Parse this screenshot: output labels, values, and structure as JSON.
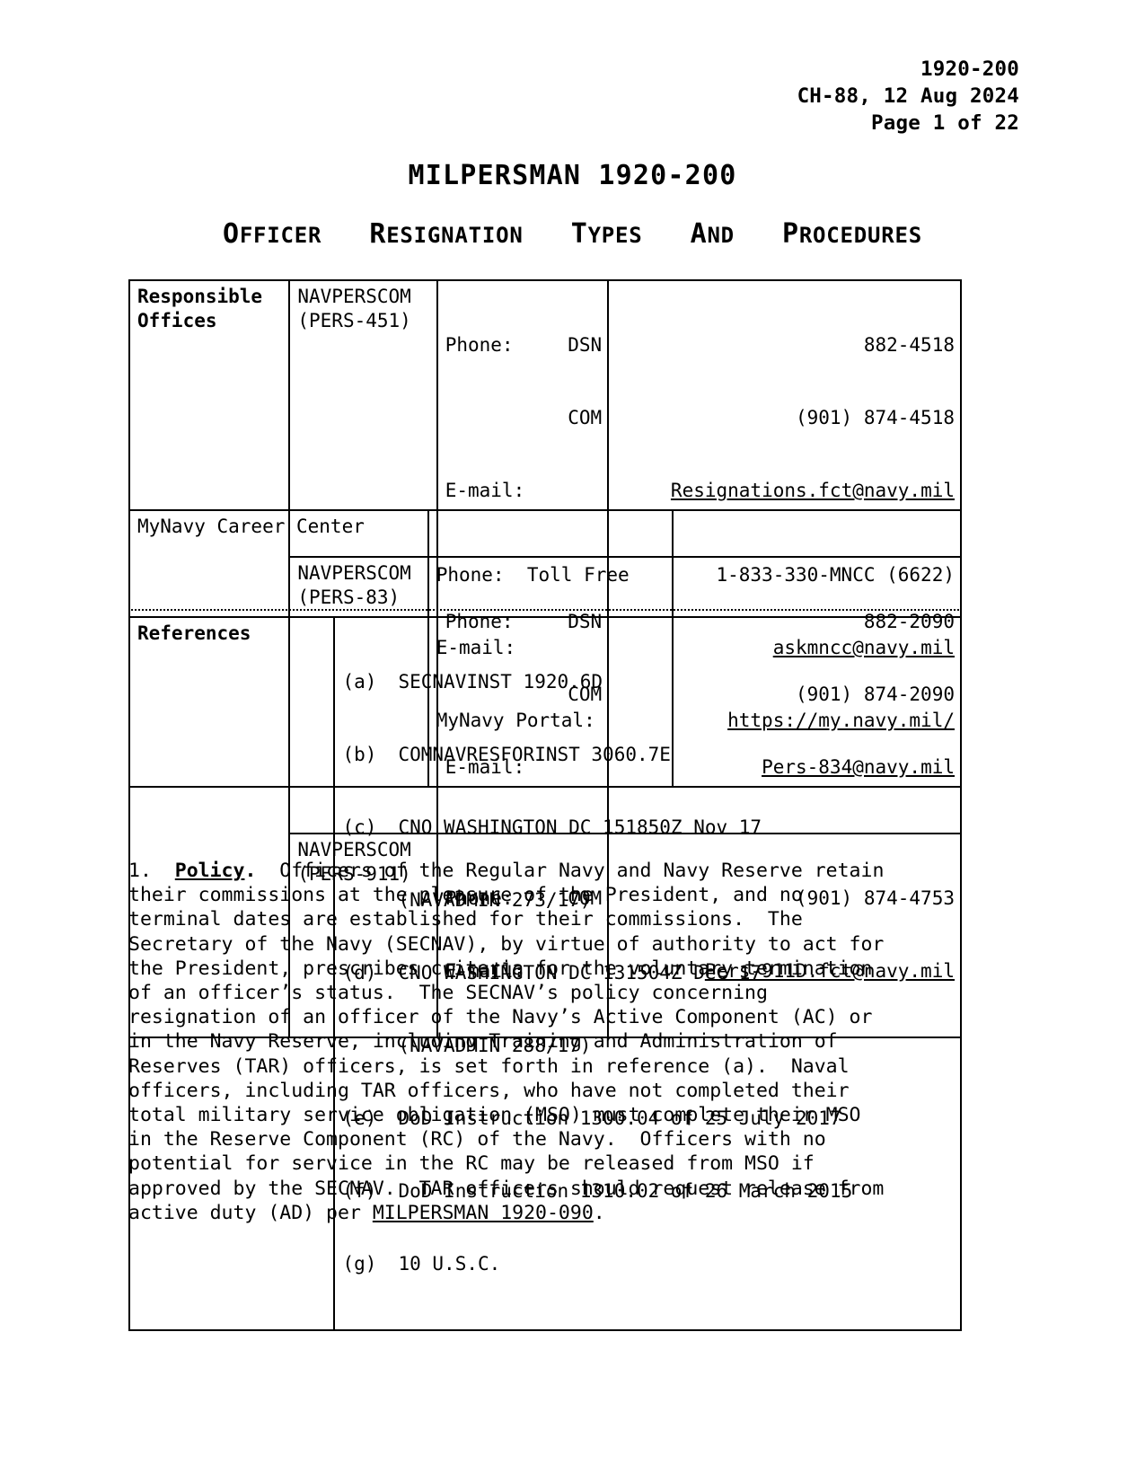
{
  "header": {
    "doc_number": "1920-200",
    "change_line": "CH-88, 12 Aug 2024",
    "page_line": "Page 1 of 22"
  },
  "title": "MILPERSMAN 1920-200",
  "subtitle": {
    "full": "OFFICER RESIGNATION TYPES AND PROCEDURES",
    "words": [
      "Officer",
      "Resignation",
      "Types",
      "and",
      "Procedures"
    ]
  },
  "offices_table": {
    "label": "Responsible\nOffices",
    "label_line1": "Responsible",
    "label_line2": "Offices",
    "rows": [
      {
        "org_line1": "NAVPERSCOM",
        "org_line2": "(PERS-451)",
        "phone_label": "Phone:",
        "dsn_label": "DSN",
        "dsn_value": "882-4518",
        "com_label": "COM",
        "com_value": "(901) 874-4518",
        "email_label": "E-mail:",
        "email_value": "Resignations.fct@navy.mil"
      },
      {
        "org_line1": "NAVPERSCOM",
        "org_line2": "(PERS-83)",
        "phone_label": "Phone:",
        "dsn_label": "DSN",
        "dsn_value": "882-2090",
        "com_label": "COM",
        "com_value": "(901) 874-2090",
        "email_label": "E-mail:",
        "email_value": "Pers-834@navy.mil"
      },
      {
        "org_line1": "NAVPERSCOM",
        "org_line2": "(PERS-911)",
        "phone_label": "Phone:",
        "com_label": "COM",
        "com_value": "(901) 874-4753",
        "email_label": "E-mail:",
        "email_value": "Pers-911D.fct@navy.mil"
      }
    ]
  },
  "mynavy_table": {
    "name": "MyNavy Career Center",
    "phone_label": "Phone:  Toll Free",
    "phone_value": "1-833-330-MNCC (6622)",
    "email_label": "E-mail:",
    "email_value": "askmncc@navy.mil",
    "portal_label": "MyNavy Portal:",
    "portal_value": "https://my.navy.mil/"
  },
  "references_table": {
    "label": "References",
    "items": [
      {
        "tag": "(a)",
        "text": "SECNAVINST 1920.6D",
        "cont": null
      },
      {
        "tag": "(b)",
        "text": "COMNAVRESFORINST 3060.7E",
        "cont": null
      },
      {
        "tag": "(c)",
        "text": "CNO WASHINGTON DC 151850Z Nov 17",
        "cont": "(NAVADMIN 273/17)"
      },
      {
        "tag": "(d)",
        "text": "CNO WASHINGTON DC 131504Z Dec 17",
        "cont": "(NAVADMIN 288/17)"
      },
      {
        "tag": "(e)",
        "text": "DoD Instruction 1300.04 of 25 July 2017",
        "cont": null
      },
      {
        "tag": "(f)",
        "text": "DoD Instruction 1310.02 of 26 March 2015",
        "cont": null
      },
      {
        "tag": "(g)",
        "text": "10 U.S.C.",
        "cont": null
      }
    ]
  },
  "policy": {
    "number": "1.",
    "heading": "Policy",
    "heading_period": ".",
    "lines": [
      "  Officers of the Regular Navy and Navy Reserve retain",
      "their commissions at the pleasure of the President, and no",
      "terminal dates are established for their commissions.  The",
      "Secretary of the Navy (SECNAV), by virtue of authority to act for",
      "the President, prescribes criteria for the voluntary termination",
      "of an officer’s status.  The SECNAV’s policy concerning",
      "resignation of an officer of the Navy’s Active Component (AC) or",
      "in the Navy Reserve, including Training and Administration of",
      "Reserves (TAR) officers, is set forth in reference (a).  Naval",
      "officers, including TAR officers, who have not completed their",
      "total military service obligation (MSO) must complete their MSO",
      "in the Reserve Component (RC) of the Navy.  Officers with no",
      "potential for service in the RC may be released from MSO if",
      "approved by the SECNAV.  TAR officers should request release from",
      "active duty (AD) per "
    ],
    "final_link": "MILPERSMAN 1920-090",
    "final_tail": "."
  }
}
